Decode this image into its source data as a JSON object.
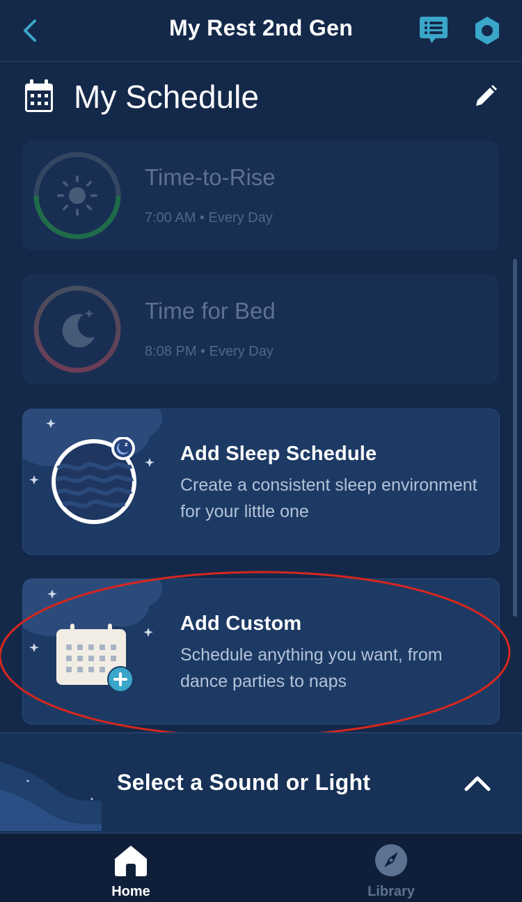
{
  "header": {
    "title": "My Rest 2nd Gen"
  },
  "schedule": {
    "title": "My Schedule",
    "items": [
      {
        "title": "Time-to-Rise",
        "subtitle": "7:00 AM • Every Day"
      },
      {
        "title": "Time for Bed",
        "subtitle": "8:08 PM • Every Day"
      }
    ],
    "add_cards": [
      {
        "title": "Add Sleep Schedule",
        "description": "Create a consistent sleep environment for your little one"
      },
      {
        "title": "Add Custom",
        "description": "Schedule anything you want, from dance parties to naps"
      }
    ]
  },
  "sound_bar": {
    "label": "Select a Sound or Light"
  },
  "tabs": [
    {
      "label": "Home"
    },
    {
      "label": "Library"
    }
  ],
  "colors": {
    "background": "#14294a",
    "accent": "#3aa6c9",
    "rise_ring": "#26a043",
    "annotation": "#d8261d"
  }
}
